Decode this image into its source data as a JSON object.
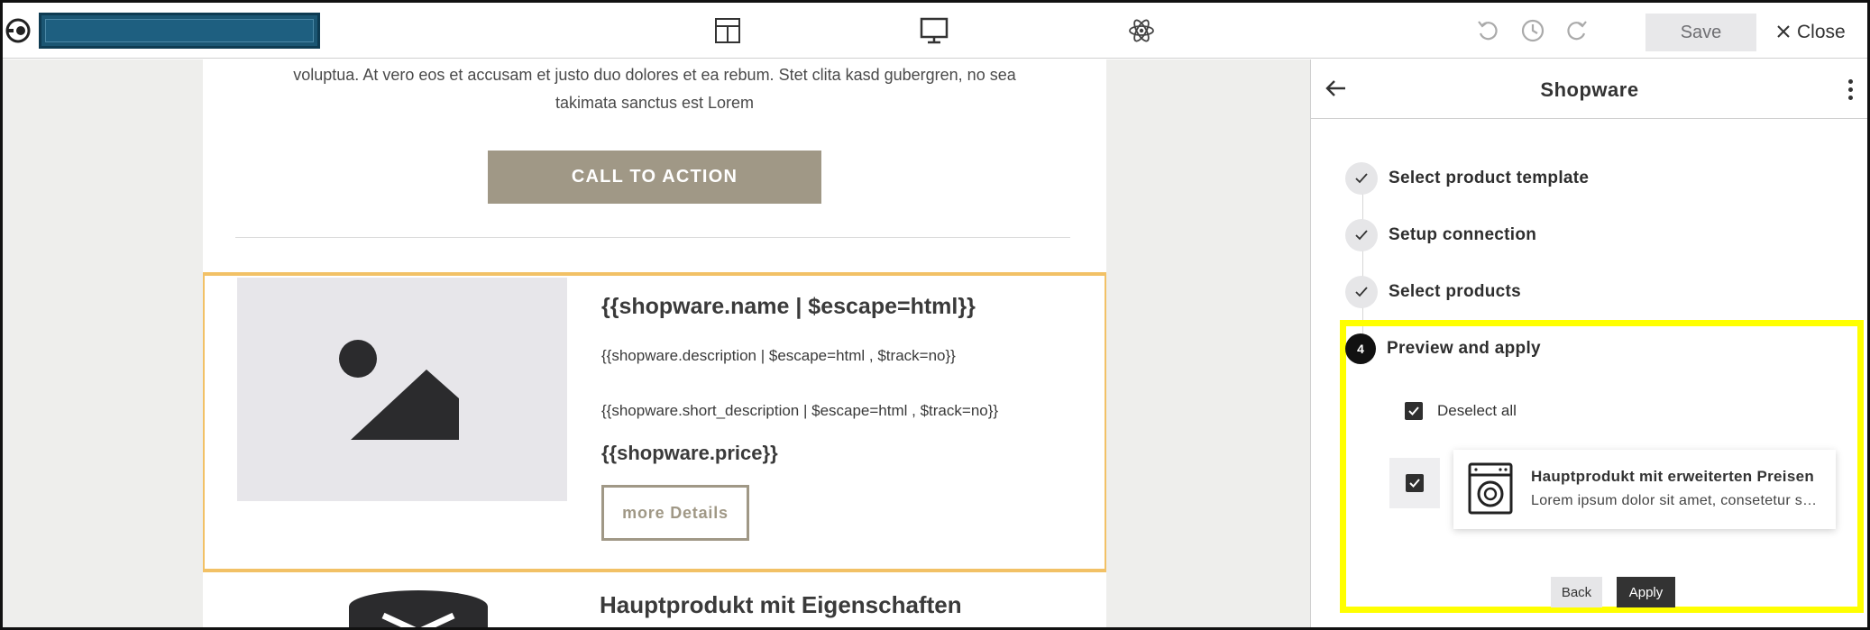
{
  "toolbar": {
    "icons": [
      "layout-icon",
      "desktop-preview-icon",
      "atom-icon",
      "undo-icon",
      "history-icon",
      "redo-icon"
    ],
    "save_label": "Save",
    "close_label": "Close"
  },
  "email": {
    "intro_line1": "voluptua. At vero eos et accusam et justo duo dolores et ea rebum. Stet clita kasd gubergren, no sea",
    "intro_line2": "takimata sanctus est Lorem",
    "cta_label": "CALL TO ACTION",
    "product": {
      "title": "{{shopware.name | $escape=html}}",
      "description": "{{shopware.description | $escape=html , $track=no}}",
      "short_description": "{{shopware.short_description | $escape=html , $track=no}}",
      "price": "{{shopware.price}}",
      "button_label": "more Details"
    },
    "next_product_title": "Hauptprodukt mit Eigenschaften"
  },
  "panel": {
    "title": "Shopware",
    "steps": [
      {
        "label": "Select product template",
        "state": "done"
      },
      {
        "label": "Setup connection",
        "state": "done"
      },
      {
        "label": "Select products",
        "state": "done"
      },
      {
        "label": "Preview and apply",
        "state": "active",
        "number": "4"
      }
    ],
    "deselect_label": "Deselect all",
    "item": {
      "title": "Hauptprodukt mit erweiterten Preisen",
      "description": "Lorem ipsum dolor sit amet, consetetur sadipscing elitr"
    },
    "back_label": "Back",
    "apply_label": "Apply"
  },
  "colors": {
    "accent": "#a09886",
    "highlight": "#ffff00",
    "selection_border": "#f2c166",
    "name_field": "#1b5673"
  }
}
